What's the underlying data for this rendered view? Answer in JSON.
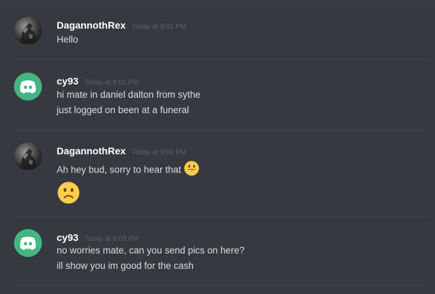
{
  "messages": [
    {
      "author": "DagannothRex",
      "timestamp": "Today at 9:01 PM",
      "avatar": "user-photo-avatar",
      "lines": [
        "Hello"
      ]
    },
    {
      "author": "cy93",
      "timestamp": "Today at 9:02 PM",
      "avatar": "discord-logo-avatar",
      "lines": [
        "hi mate in daniel dalton from sythe",
        "just logged on been at a funeral"
      ]
    },
    {
      "author": "DagannothRex",
      "timestamp": "Today at 9:02 PM",
      "avatar": "user-photo-avatar",
      "lines": [
        "Ah hey bud, sorry to hear that"
      ],
      "emojis": [
        "smiley-emoji",
        "frowning-emoji"
      ]
    },
    {
      "author": "cy93",
      "timestamp": "Today at 9:03 PM",
      "avatar": "discord-logo-avatar",
      "lines": [
        "no worries mate, can you send pics on here?",
        "ill show you im good for the cash"
      ]
    }
  ],
  "colors": {
    "background": "#36393f",
    "username": "#ffffff",
    "message_text": "#dcddde",
    "timestamp": "#5d6067",
    "divider": "#42454b",
    "discord_avatar": "#43b581",
    "emoji_yellow": "#ffcc4d"
  }
}
